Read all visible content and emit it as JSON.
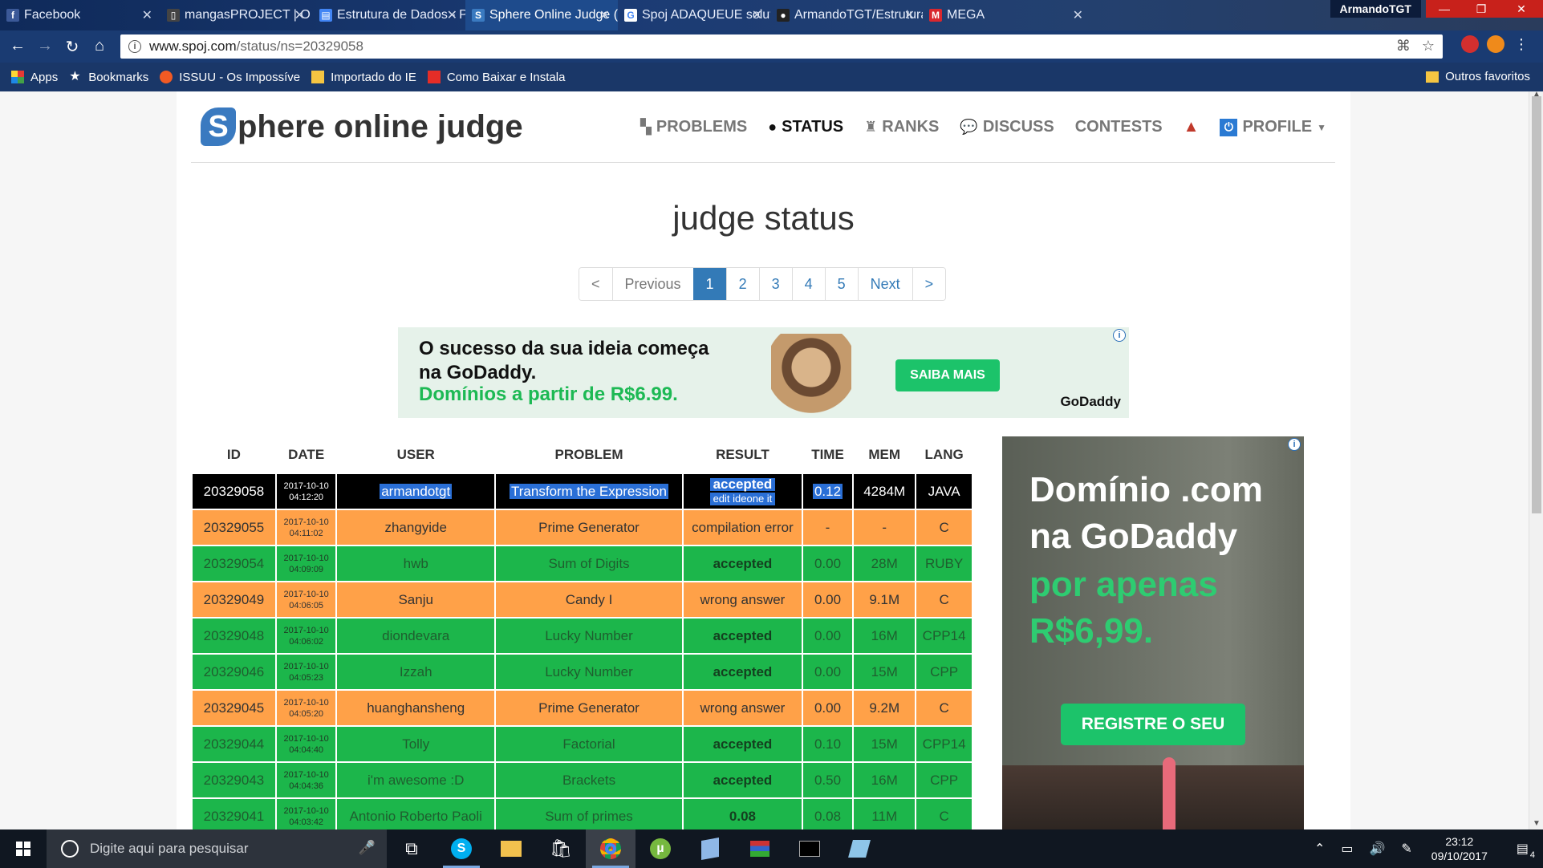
{
  "browser": {
    "tabs": [
      {
        "title": "Facebook",
        "icon": "facebook-icon",
        "color": "#3b5998",
        "glyph": "f"
      },
      {
        "title": "mangasPROJECT | O se",
        "icon": "book-icon",
        "color": "#444444",
        "glyph": "▯"
      },
      {
        "title": "Estrutura de Dados - P",
        "icon": "docs-icon",
        "color": "#4285f4",
        "glyph": "▤"
      },
      {
        "title": "Sphere Online Judge (S",
        "icon": "spoj-icon",
        "color": "#3a7ac0",
        "glyph": "S",
        "active": true
      },
      {
        "title": "Spoj ADAQUEUE soluti",
        "icon": "google-icon",
        "color": "#ffffff",
        "glyph": "G"
      },
      {
        "title": "ArmandoTGT/Estrutura",
        "icon": "github-icon",
        "color": "#222222",
        "glyph": "●"
      },
      {
        "title": "MEGA",
        "icon": "mega-icon",
        "color": "#d9272e",
        "glyph": "M"
      }
    ],
    "profile_name": "ArmandoTGT",
    "url_host": "www.spoj.com",
    "url_path": "/status/ns=20329058",
    "bookmarks": [
      {
        "label": "Apps",
        "icon": "apps-grid-icon"
      },
      {
        "label": "Bookmarks",
        "icon": "star-icon"
      },
      {
        "label": "ISSUU - Os Impossíve",
        "icon": "issuu-icon"
      },
      {
        "label": "Importado do IE",
        "icon": "folder-icon"
      },
      {
        "label": "Como Baixar e Instala",
        "icon": "youtube-icon"
      }
    ],
    "other_bookmarks": "Outros favoritos"
  },
  "site": {
    "logo_s": "S",
    "logo_text": "phere online judge",
    "nav": [
      {
        "label": "PROBLEMS",
        "icon": "sitemap-icon",
        "glyph": "▚"
      },
      {
        "label": "STATUS",
        "icon": "circle-icon",
        "glyph": "●",
        "active": true
      },
      {
        "label": "RANKS",
        "icon": "trophy-icon",
        "glyph": "♜"
      },
      {
        "label": "DISCUSS",
        "icon": "comments-icon",
        "glyph": "💬"
      },
      {
        "label": "CONTESTS",
        "icon": "",
        "glyph": ""
      }
    ],
    "profile_label": "PROFILE",
    "title": "judge status",
    "pagination": [
      "<",
      "Previous",
      "1",
      "2",
      "3",
      "4",
      "5",
      "Next",
      ">"
    ],
    "current_page": "1"
  },
  "ads": {
    "banner_line1": "O sucesso da sua ideia começa",
    "banner_line2": "na GoDaddy.",
    "banner_line3": "Domínios a partir de R$6.99.",
    "banner_cta": "SAIBA MAIS",
    "banner_brand": "GoDaddy",
    "side_line1": "Domínio .com",
    "side_line2": "na GoDaddy",
    "side_line3": "por apenas",
    "side_line4": "R$6,99.",
    "side_cta": "REGISTRE O SEU"
  },
  "table": {
    "headers": [
      "ID",
      "DATE",
      "USER",
      "PROBLEM",
      "RESULT",
      "TIME",
      "MEM",
      "LANG"
    ],
    "rows": [
      {
        "id": "20329058",
        "date": "2017-10-10",
        "time_of_day": "04:12:20",
        "user": "armandotgt",
        "problem": "Transform the Expression",
        "result": "accepted",
        "result_links": "edit   ideone it",
        "time": "0.12",
        "mem": "4284M",
        "lang": "JAVA",
        "style": "black"
      },
      {
        "id": "20329055",
        "date": "2017-10-10",
        "time_of_day": "04:11:02",
        "user": "zhangyide",
        "problem": "Prime Generator",
        "result": "compilation error",
        "time": "-",
        "mem": "-",
        "lang": "C",
        "style": "orange"
      },
      {
        "id": "20329054",
        "date": "2017-10-10",
        "time_of_day": "04:09:09",
        "user": "hwb",
        "problem": "Sum of Digits",
        "result": "accepted",
        "time": "0.00",
        "mem": "28M",
        "lang": "RUBY",
        "style": "green"
      },
      {
        "id": "20329049",
        "date": "2017-10-10",
        "time_of_day": "04:06:05",
        "user": "Sanju",
        "problem": "Candy I",
        "result": "wrong answer",
        "time": "0.00",
        "mem": "9.1M",
        "lang": "C",
        "style": "orange"
      },
      {
        "id": "20329048",
        "date": "2017-10-10",
        "time_of_day": "04:06:02",
        "user": "diondevara",
        "problem": "Lucky Number",
        "result": "accepted",
        "time": "0.00",
        "mem": "16M",
        "lang": "CPP14",
        "style": "green"
      },
      {
        "id": "20329046",
        "date": "2017-10-10",
        "time_of_day": "04:05:23",
        "user": "Izzah",
        "problem": "Lucky Number",
        "result": "accepted",
        "time": "0.00",
        "mem": "15M",
        "lang": "CPP",
        "style": "green"
      },
      {
        "id": "20329045",
        "date": "2017-10-10",
        "time_of_day": "04:05:20",
        "user": "huanghansheng",
        "problem": "Prime Generator",
        "result": "wrong answer",
        "time": "0.00",
        "mem": "9.2M",
        "lang": "C",
        "style": "orange"
      },
      {
        "id": "20329044",
        "date": "2017-10-10",
        "time_of_day": "04:04:40",
        "user": "Tolly",
        "problem": "Factorial",
        "result": "accepted",
        "time": "0.10",
        "mem": "15M",
        "lang": "CPP14",
        "style": "green"
      },
      {
        "id": "20329043",
        "date": "2017-10-10",
        "time_of_day": "04:04:36",
        "user": "i'm awesome :D",
        "problem": "Brackets",
        "result": "accepted",
        "time": "0.50",
        "mem": "16M",
        "lang": "CPP",
        "style": "green"
      },
      {
        "id": "20329041",
        "date": "2017-10-10",
        "time_of_day": "04:03:42",
        "user": "Antonio Roberto Paoli",
        "problem": "Sum of primes",
        "result": "0.08",
        "time": "0.08",
        "mem": "11M",
        "lang": "C",
        "style": "green"
      }
    ]
  },
  "taskbar": {
    "search_placeholder": "Digite aqui para pesquisar",
    "time": "23:12",
    "date": "09/10/2017",
    "notifications": "4"
  },
  "colors": {
    "accepted": "#1cb64b",
    "wrong": "#ffa148",
    "selected": "#000000",
    "link": "#337ab7"
  }
}
